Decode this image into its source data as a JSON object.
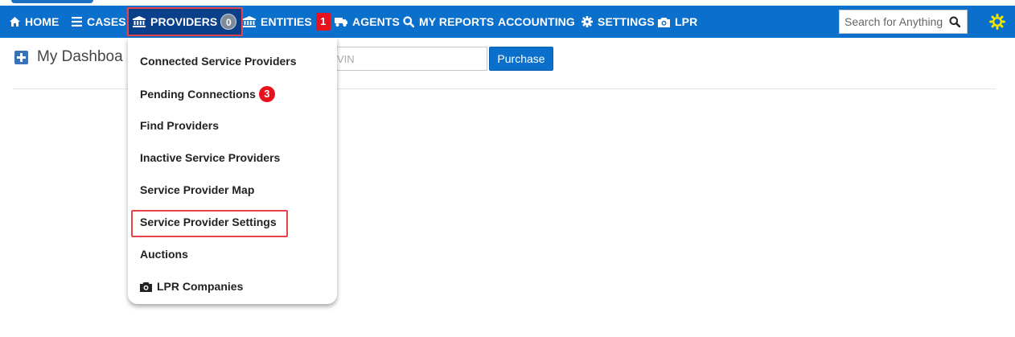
{
  "navbar": {
    "items": [
      {
        "label": "HOME",
        "icon": "home-icon"
      },
      {
        "label": "CASES",
        "icon": "menu-icon"
      },
      {
        "label": "PROVIDERS",
        "icon": "bank-icon",
        "badge": "0"
      },
      {
        "label": "ENTITIES",
        "icon": "bank-icon",
        "badge": "1"
      },
      {
        "label": "AGENTS",
        "icon": "truck-icon"
      },
      {
        "label": "MY REPORTS",
        "icon": "search-icon"
      },
      {
        "label": "ACCOUNTING"
      },
      {
        "label": "SETTINGS",
        "icon": "gear-icon"
      },
      {
        "label": "LPR",
        "icon": "camera-icon"
      }
    ],
    "search_placeholder": "Search for Anything",
    "colors": {
      "bar": "#0b6fcc",
      "active": "#0a3f8a",
      "highlight": "#e8424a",
      "badge_red": "#e8121e",
      "gear": "#f2e600"
    }
  },
  "dashboard": {
    "title": "My Dashboa",
    "vin_placeholder": "VIN",
    "purchase_label": "Purchase"
  },
  "providers_menu": {
    "items": [
      {
        "label": "Connected Service Providers"
      },
      {
        "label": "Pending Connections",
        "badge": "3"
      },
      {
        "label": "Find Providers"
      },
      {
        "label": "Inactive Service Providers"
      },
      {
        "label": "Service Provider Map"
      },
      {
        "label": "Service Provider Settings",
        "highlighted": true
      },
      {
        "label": "Auctions"
      },
      {
        "label": "LPR Companies",
        "icon": "camera-icon"
      }
    ]
  }
}
